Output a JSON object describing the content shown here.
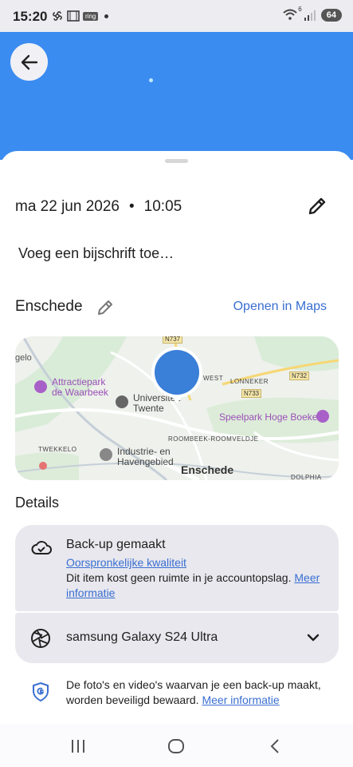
{
  "status_bar": {
    "time": "15:20",
    "icons": [
      "pinwheel-icon",
      "film-icon",
      "ring-app-icon",
      "dot-icon"
    ],
    "ring_label": "ring",
    "wifi_badge": "6",
    "battery": "64"
  },
  "header": {
    "back_icon": "arrow-left-icon",
    "photo_color": "#3b8cf0"
  },
  "info": {
    "date": "ma 22 jun 2026",
    "separator": "•",
    "time": "10:05",
    "caption_placeholder": "Voeg een bijschrift toe…"
  },
  "location": {
    "name": "Enschede",
    "open_maps": "Openen in Maps",
    "map": {
      "labels": {
        "gelo": "gelo",
        "attractiepark1": "Attractiepark",
        "attractiepark2": "de Waarbeek",
        "universiteit1": "Universiteit",
        "universiteit2": "Twente",
        "west": "WEST",
        "lonneker": "LONNEKER",
        "speelpark": "Speelpark Hoge Boekel",
        "twekkelo": "TWEKKELO",
        "industrie1": "Industrie- en",
        "industrie2": "Havengebied",
        "roombeek": "ROOMBEEK-ROOMVELDJE",
        "enschede": "Enschede",
        "dolphia": "DOLPHIA"
      },
      "roads": {
        "n737": "N737",
        "n732": "N732",
        "n733": "N733"
      }
    }
  },
  "details": {
    "heading": "Details",
    "backup": {
      "title": "Back-up gemaakt",
      "quality_link": "Oorspronkelijke kwaliteit",
      "description": "Dit item kost geen ruimte in je accountopslag.",
      "more_link": "Meer informatie"
    },
    "device": {
      "name": "samsung Galaxy S24 Ultra"
    },
    "security": {
      "text": "De foto's en video's waarvan je een back-up maakt, worden beveiligd bewaard.",
      "more_link": "Meer informatie"
    }
  },
  "colors": {
    "accent": "#3a6ed1",
    "card_bg": "#e8e8ee",
    "map_pin": "#3a7fd8"
  }
}
